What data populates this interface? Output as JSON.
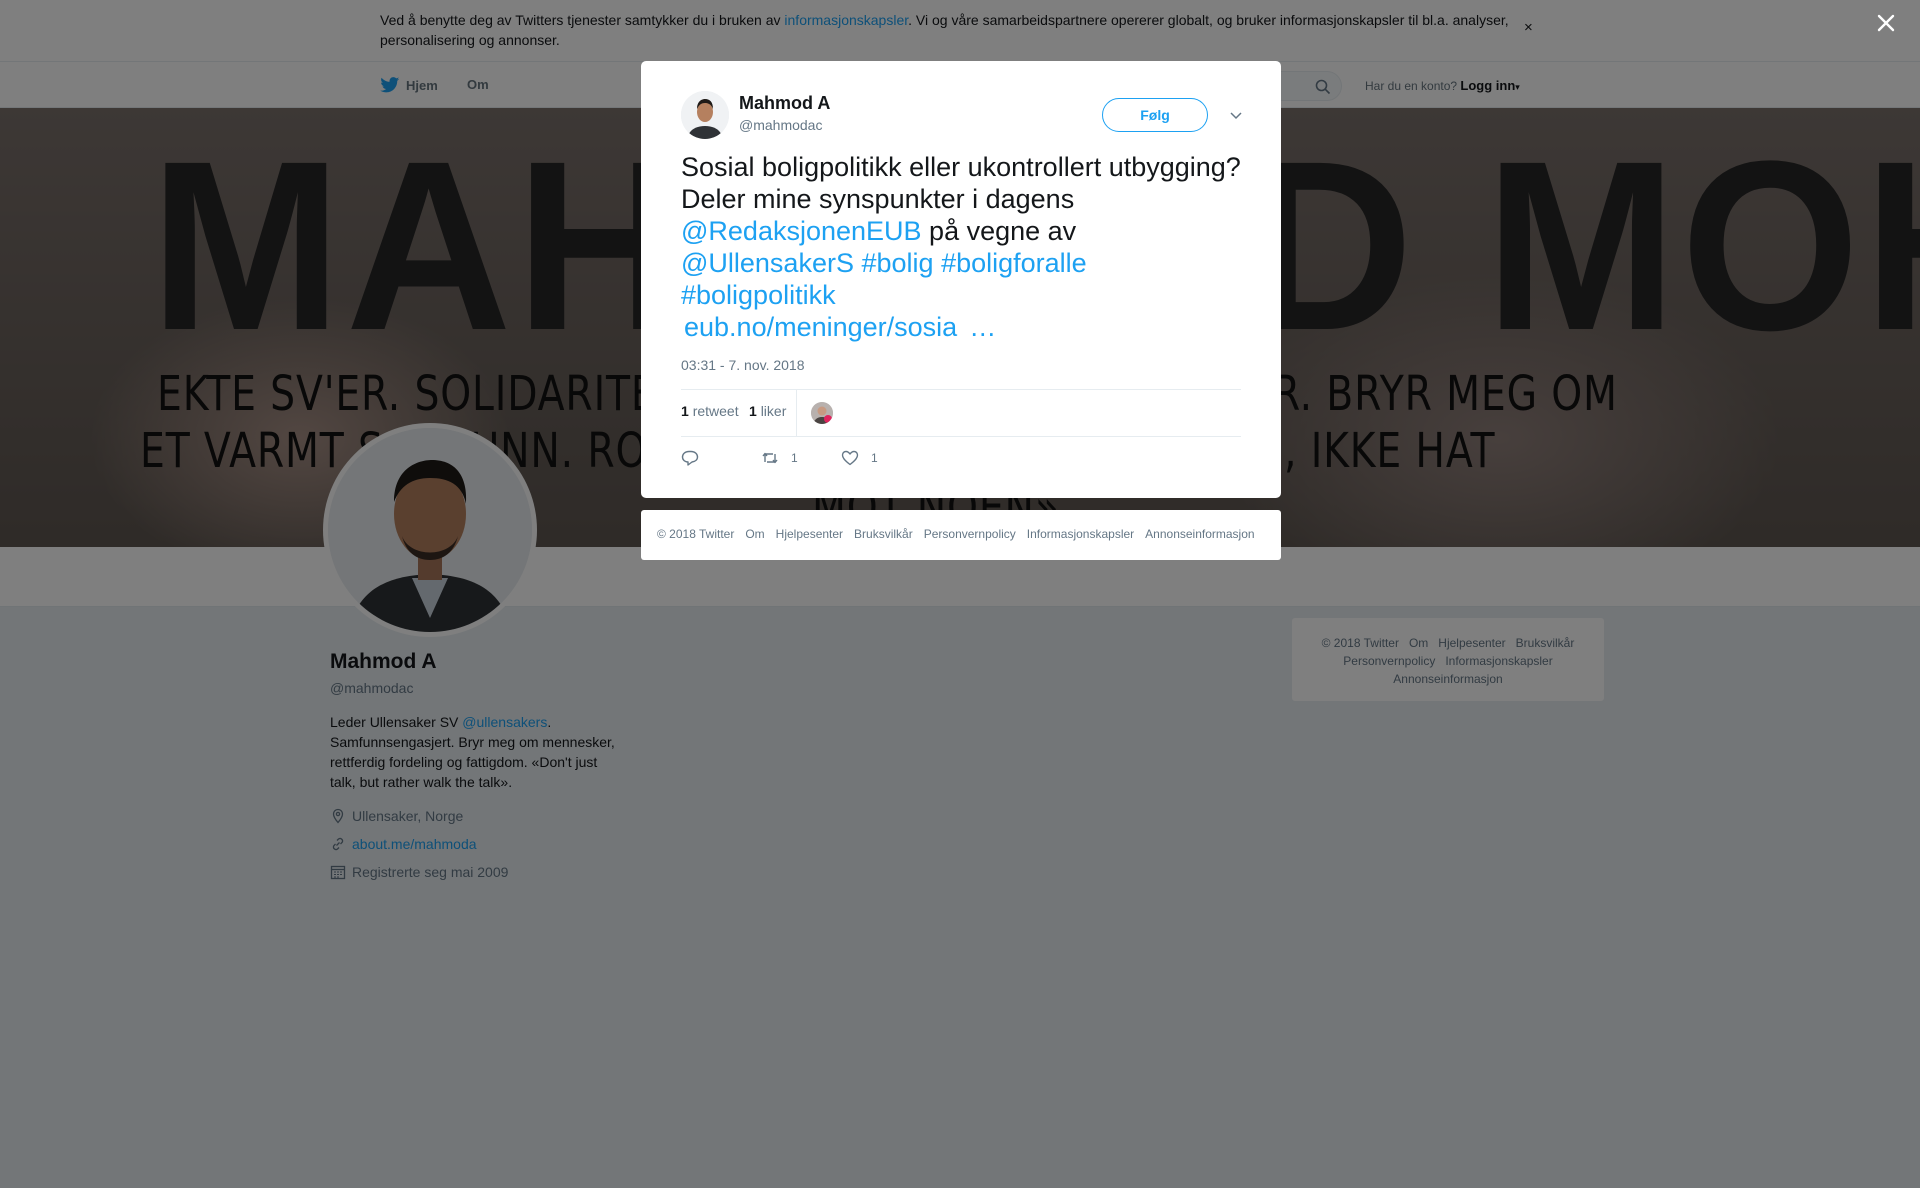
{
  "cookie_banner": {
    "text_before": "Ved å benytte deg av Twitters tjenester samtykker du i bruken av ",
    "link": "informasjonskapsler",
    "text_after": ". Vi og våre samarbeidspartnere opererer globalt, og bruker informasjonskapsler til bl.a. analyser, personalisering og annonser.",
    "close": "×"
  },
  "nav": {
    "home": "Hjem",
    "about": "Om",
    "account_prompt": "Har du en konto?",
    "login": "Logg inn"
  },
  "banner": {
    "big_text": "MAHMOOD MOHAMMAD",
    "line1": "EKTE SV'ER. SOLIDARITET, LIKEVERD OG ROBUSTHETER. BRYR MEG OM",
    "line2": "ET VARMT SAMFUNN. ROM OG PLASS TIL ALLE, TIL ALLE, IKKE HAT",
    "line3": "MOT NOEN»"
  },
  "profile": {
    "name": "Mahmod A",
    "handle": "@mahmodac",
    "bio_before": "Leder Ullensaker SV ",
    "bio_link": "@ullensakers",
    "bio_after": ". Samfunnsengasjert. Bryr meg om mennesker, rettferdig fordeling og fattigdom. «Don't just talk, but rather walk the talk».",
    "location": "Ullensaker, Norge",
    "website": "about.me/mahmoda",
    "joined": "Registrerte seg mai 2009"
  },
  "side_footer": {
    "row1": [
      "© 2018 Twitter",
      "Om",
      "Hjelpesenter",
      "Bruksvilkår"
    ],
    "row2": [
      "Personvernpolicy",
      "Informasjonskapsler"
    ],
    "row3": [
      "Annonseinformasjon"
    ]
  },
  "tweet": {
    "author_name": "Mahmod A",
    "author_handle": "@mahmodac",
    "follow_label": "Følg",
    "text_1": "Sosial boligpolitikk eller ukontrollert utbygging? Deler mine synspunkter i dagens ",
    "mention_1": "@RedaksjonenEUB",
    "text_2": " på vegne av ",
    "mention_2": "@UllensakerS",
    "hashtag_1": "#bolig",
    "hashtag_2": "#boligforalle",
    "hashtag_3": "#boligpolitikk",
    "link": "eub.no/meninger/sosia",
    "ellipsis": "…",
    "timestamp": "03:31 - 7. nov. 2018",
    "retweet_count": "1",
    "retweet_label": "retweet",
    "like_count": "1",
    "like_label": "liker",
    "action_retweets": "1",
    "action_likes": "1"
  },
  "modal_footer": [
    "© 2018 Twitter",
    "Om",
    "Hjelpesenter",
    "Bruksvilkår",
    "Personvernpolicy",
    "Informasjonskapsler",
    "Annonseinformasjon"
  ],
  "colors": {
    "accent": "#1da1f2",
    "overlay": "rgba(0,0,0,0.5)"
  }
}
